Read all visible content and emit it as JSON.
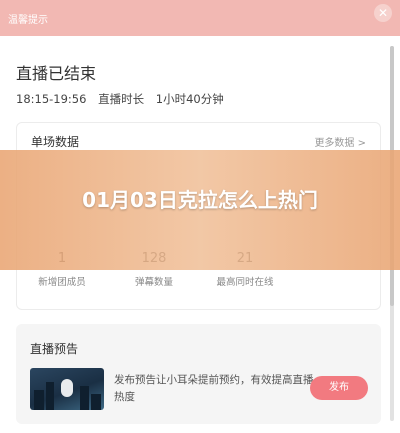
{
  "modal": {
    "title": "温馨提示",
    "close_label": "✕"
  },
  "live": {
    "title": "直播已结束",
    "time_range": "18:15-19:56",
    "duration_label": "直播时长",
    "duration_value": "1小时40分钟"
  },
  "stats_card": {
    "title": "单场数据",
    "more_label": "更多数据 >",
    "stats": [
      {
        "value": "1",
        "label": "新增团成员"
      },
      {
        "value": "128",
        "label": "弹幕数量"
      },
      {
        "value": "21",
        "label": "最高同时在线"
      }
    ]
  },
  "preview_card": {
    "title": "直播预告",
    "text": "发布预告让小耳朵提前预约，有效提高直播热度",
    "publish_label": "发布"
  },
  "overlay": {
    "headline": "01月03日克拉怎么上热门"
  },
  "colors": {
    "header_bg": "#f2b8b3",
    "accent_button": "#f27a80",
    "overlay_band": "#e9a573"
  }
}
